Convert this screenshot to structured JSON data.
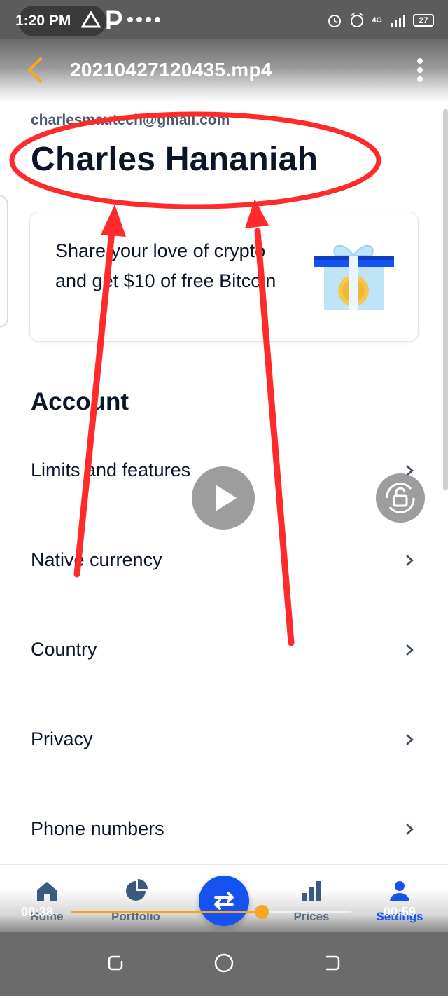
{
  "status_bar": {
    "time": "1:20 PM",
    "network": "4G",
    "battery": "27"
  },
  "player": {
    "file_title": "20210427120435.mp4",
    "elapsed": "00:38",
    "total": "00:59",
    "progress": 0.68
  },
  "profile": {
    "email": "charlesmautech@gmail.com",
    "name": "Charles Hananiah"
  },
  "referral": {
    "text": "Share your love of crypto and get $10 of free Bitcoin"
  },
  "account": {
    "title": "Account",
    "items": [
      {
        "label": "Limits and features"
      },
      {
        "label": "Native currency"
      },
      {
        "label": "Country"
      },
      {
        "label": "Privacy"
      },
      {
        "label": "Phone numbers"
      }
    ]
  },
  "bottom_nav": {
    "items": [
      {
        "label": "Home",
        "icon": "home-icon"
      },
      {
        "label": "Portfolio",
        "icon": "pie-chart-icon"
      },
      {
        "label": "Trade",
        "icon": "swap-arrows-icon"
      },
      {
        "label": "Prices",
        "icon": "bar-chart-icon"
      },
      {
        "label": "Settings",
        "icon": "person-icon"
      }
    ]
  },
  "colors": {
    "accent_blue": "#1652f0",
    "annotation_red": "#ff2b2b",
    "progress_orange": "#f5a623"
  }
}
